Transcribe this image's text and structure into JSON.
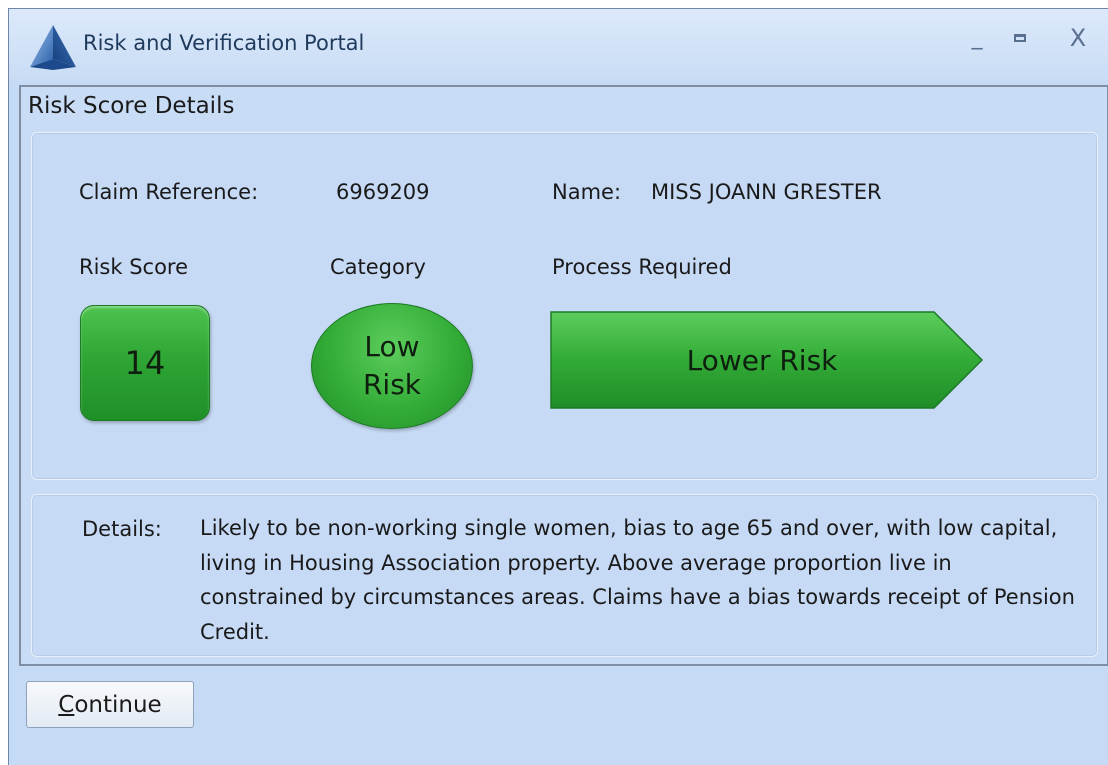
{
  "window": {
    "title": "Risk and Verification Portal",
    "min_symbol": "_",
    "close_symbol": "X"
  },
  "frame": {
    "title": "Risk Score Details"
  },
  "claim": {
    "reference_label": "Claim Reference:",
    "reference_value": "6969209",
    "name_label": "Name:",
    "name_value": "MISS JOANN GRESTER"
  },
  "score": {
    "risk_score_label": "Risk Score",
    "risk_score_value": "14",
    "category_label": "Category",
    "category_line1": "Low",
    "category_line2": "Risk",
    "process_label": "Process Required",
    "process_value": "Lower Risk"
  },
  "details": {
    "label": "Details:",
    "text": "Likely to be non-working single women, bias to age 65 and over, with low capital, living in Housing Association property.  Above average proportion live in constrained by circumstances areas. Claims have a bias towards receipt of Pension Credit."
  },
  "actions": {
    "continue_first_letter": "C",
    "continue_rest": "ontinue"
  },
  "icons": {
    "app_logo": "pyramid-logo-icon",
    "minimize": "minimize-icon",
    "maximize": "maximize-icon",
    "close": "close-icon"
  },
  "colors": {
    "window_bg": "#c5daf5",
    "indicator_green": "#2fa635",
    "title_text": "#1e3a5c"
  }
}
